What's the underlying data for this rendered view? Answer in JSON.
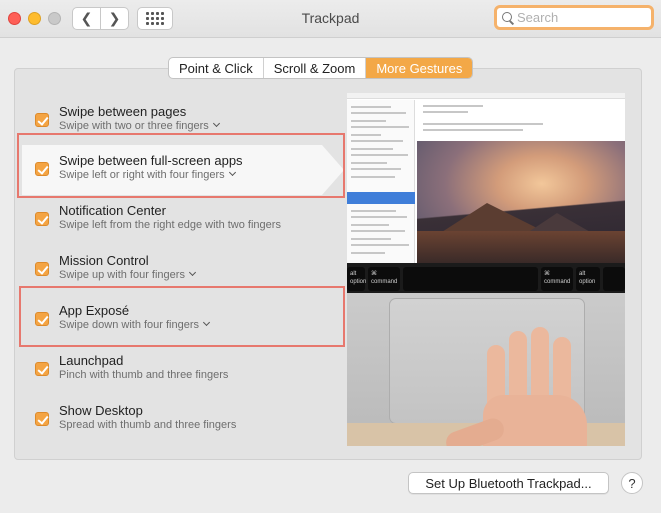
{
  "window": {
    "title": "Trackpad"
  },
  "toolbar": {
    "back_icon": "chevron-left-icon",
    "forward_icon": "chevron-right-icon",
    "grid_icon": "show-all-grid-icon",
    "search_placeholder": "Search"
  },
  "tabs": [
    {
      "label": "Point & Click",
      "active": false
    },
    {
      "label": "Scroll & Zoom",
      "active": false
    },
    {
      "label": "More Gestures",
      "active": true
    }
  ],
  "gestures": [
    {
      "title": "Swipe between pages",
      "subtitle": "Swipe with two or three fingers",
      "has_dropdown": true,
      "checked": true
    },
    {
      "title": "Swipe between full-screen apps",
      "subtitle": "Swipe left or right with four fingers",
      "has_dropdown": true,
      "checked": true,
      "selected": true
    },
    {
      "title": "Notification Center",
      "subtitle": "Swipe left from the right edge with two fingers",
      "has_dropdown": false,
      "checked": true
    },
    {
      "title": "Mission Control",
      "subtitle": "Swipe up with four fingers",
      "has_dropdown": true,
      "checked": true
    },
    {
      "title": "App Exposé",
      "subtitle": "Swipe down with four fingers",
      "has_dropdown": true,
      "checked": true
    },
    {
      "title": "Launchpad",
      "subtitle": "Pinch with thumb and three fingers",
      "has_dropdown": false,
      "checked": true
    },
    {
      "title": "Show Desktop",
      "subtitle": "Spread with thumb and three fingers",
      "has_dropdown": false,
      "checked": true
    }
  ],
  "preview": {
    "keys": [
      {
        "top": "alt",
        "bottom": "option"
      },
      {
        "top": "⌘",
        "bottom": "command"
      },
      {
        "top": "⌘",
        "bottom": "command"
      },
      {
        "top": "alt",
        "bottom": "option"
      }
    ]
  },
  "footer": {
    "bluetooth_button": "Set Up Bluetooth Trackpad...",
    "help_label": "?"
  },
  "colors": {
    "accent": "#f3a847",
    "highlight": "#e7786e"
  }
}
